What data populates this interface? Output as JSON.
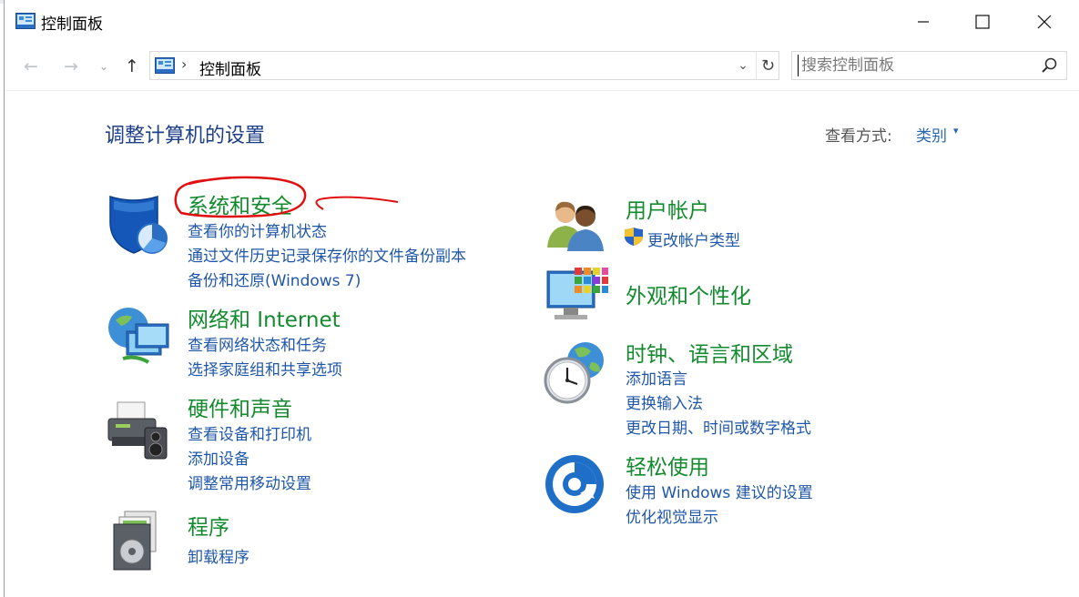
{
  "window": {
    "title": "控制面板",
    "min_glyph": "—",
    "max_glyph": "☐",
    "close_glyph": "✕"
  },
  "nav": {
    "back_glyph": "←",
    "forward_glyph": "→",
    "recent_glyph": "⌄",
    "up_glyph": "↑"
  },
  "address": {
    "separator": "›",
    "path": "控制面板",
    "dropdown_glyph": "⌄",
    "refresh_glyph": "↻"
  },
  "search": {
    "placeholder": "搜索控制面板"
  },
  "content": {
    "heading": "调整计算机的设置",
    "view_by_label": "查看方式:",
    "view_by_value": "类别",
    "view_by_caret": "▾"
  },
  "categories_left": [
    {
      "title": "系统和安全",
      "icon": "shield-icon",
      "links": [
        "查看你的计算机状态",
        "通过文件历史记录保存你的文件备份副本",
        "备份和还原(Windows 7)"
      ]
    },
    {
      "title": "网络和 Internet",
      "icon": "network-icon",
      "links": [
        "查看网络状态和任务",
        "选择家庭组和共享选项"
      ]
    },
    {
      "title": "硬件和声音",
      "icon": "printer-icon",
      "links": [
        "查看设备和打印机",
        "添加设备",
        "调整常用移动设置"
      ]
    },
    {
      "title": "程序",
      "icon": "programs-icon",
      "links": [
        "卸载程序"
      ]
    }
  ],
  "categories_right": [
    {
      "title": "用户帐户",
      "icon": "users-icon",
      "links": [
        "更改帐户类型"
      ]
    },
    {
      "title": "外观和个性化",
      "icon": "display-icon",
      "links": []
    },
    {
      "title": "时钟、语言和区域",
      "icon": "clock-globe-icon",
      "links": [
        "添加语言",
        "更换输入法",
        "更改日期、时间或数字格式"
      ]
    },
    {
      "title": "轻松使用",
      "icon": "ease-of-access-icon",
      "links": [
        "使用 Windows 建议的设置",
        "优化视觉显示"
      ]
    }
  ],
  "colors": {
    "heading": "#1e3f8a",
    "category_title": "#138a2e",
    "link": "#1f57a8",
    "annotation": "#e01010"
  }
}
